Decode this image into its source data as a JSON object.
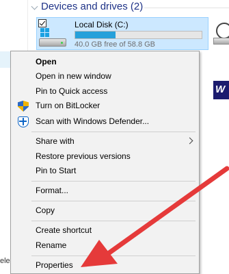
{
  "left_pane": {
    "partial_text": "elec"
  },
  "devices_group": {
    "title": "Devices and drives (2)"
  },
  "drive": {
    "name": "Local Disk (C:)",
    "free_text": "40.0 GB free of 58.8 GB",
    "used_fraction": 0.32
  },
  "context_menu": {
    "items": [
      {
        "label": "Open"
      },
      {
        "label": "Open in new window"
      },
      {
        "label": "Pin to Quick access"
      },
      {
        "label": "Turn on BitLocker"
      },
      {
        "label": "Scan with Windows Defender..."
      },
      {
        "label": "Share with"
      },
      {
        "label": "Restore previous versions"
      },
      {
        "label": "Pin to Start"
      },
      {
        "label": "Format..."
      },
      {
        "label": "Copy"
      },
      {
        "label": "Create shortcut"
      },
      {
        "label": "Rename"
      },
      {
        "label": "Properties"
      }
    ]
  },
  "colors": {
    "accent": "#26a0da",
    "selection": "#cce8ff",
    "annotation_arrow": "#e53a3a"
  },
  "icons": [
    "chevron-down-icon",
    "checkbox-checked-icon",
    "windows-logo-icon",
    "hard-disk-icon",
    "cd-drive-icon",
    "wd-logo-icon",
    "bitlocker-shield-icon",
    "windows-defender-icon",
    "chevron-right-icon",
    "red-arrow-annotation"
  ]
}
